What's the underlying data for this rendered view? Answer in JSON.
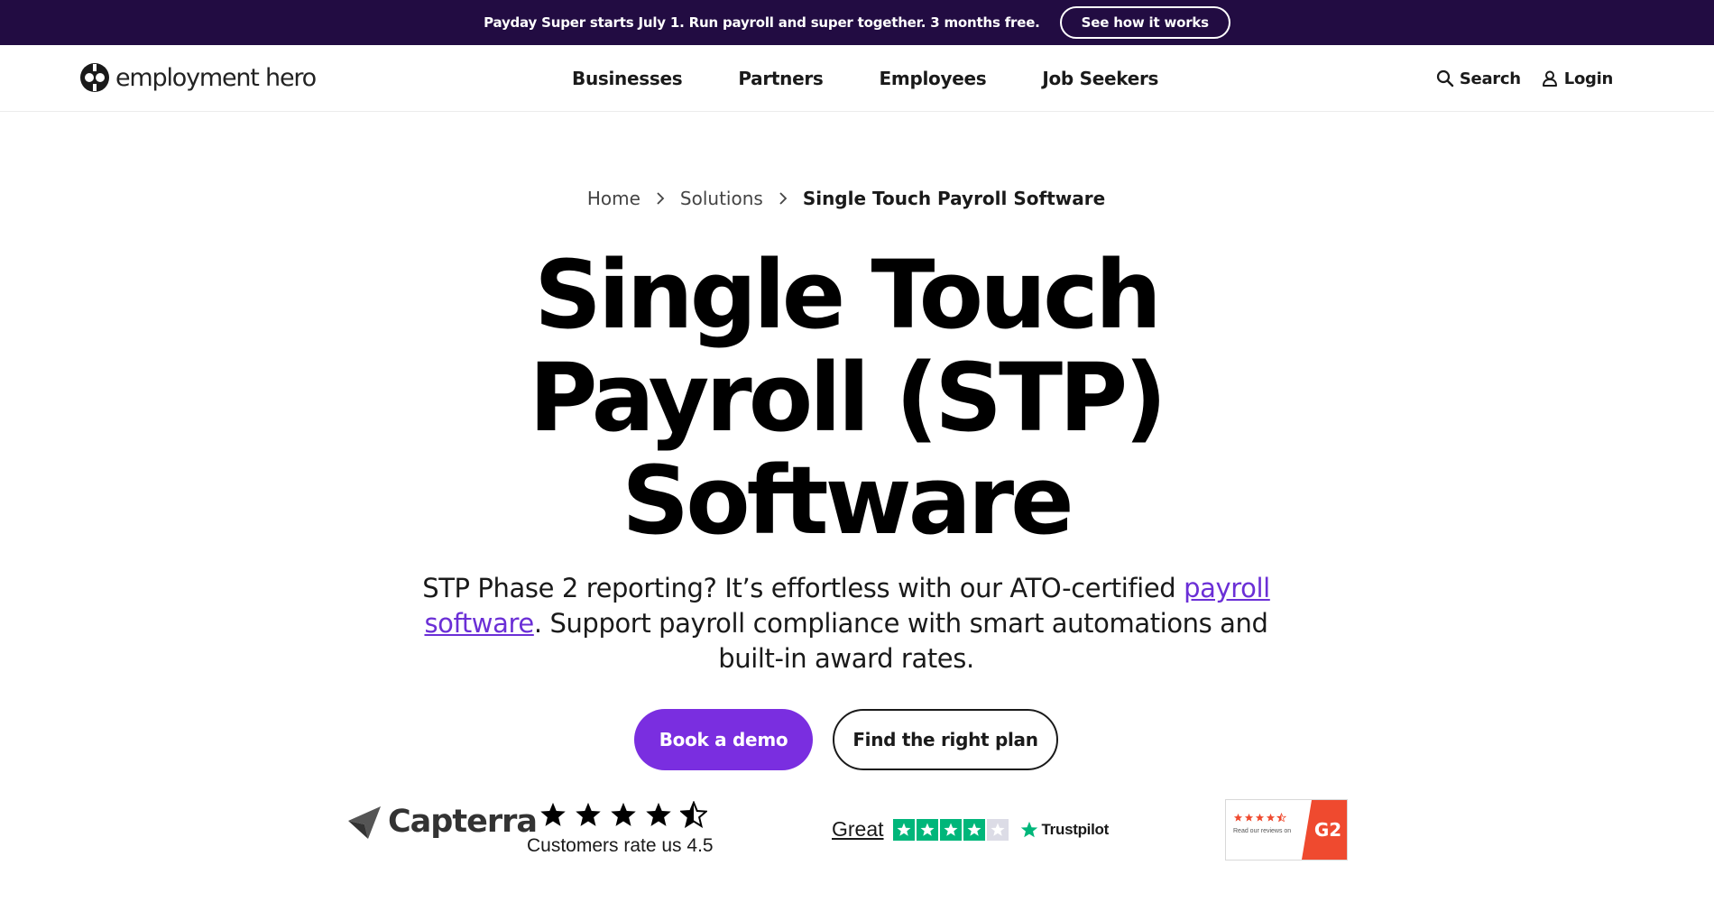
{
  "promo": {
    "text": "Payday Super starts July 1. Run payroll and super together. 3 months free.",
    "button": "See how it works"
  },
  "header": {
    "logo_text": "employment hero",
    "nav": [
      "Businesses",
      "Partners",
      "Employees",
      "Job Seekers"
    ],
    "search_label": "Search",
    "login_label": "Login"
  },
  "breadcrumb": {
    "home": "Home",
    "solutions": "Solutions",
    "current": "Single Touch Payroll Software"
  },
  "hero": {
    "title_line1": "Single Touch",
    "title_line2": "Payroll (STP)",
    "title_line3": "Software",
    "subtitle_before": "STP Phase 2 reporting? It’s effortless with our ATO-certified ",
    "subtitle_link": "payroll software",
    "subtitle_after": ". Support payroll compliance with smart automations and built-in award rates.",
    "primary_cta": "Book a demo",
    "secondary_cta": "Find the right plan"
  },
  "ratings": {
    "capterra": {
      "name": "Capterra",
      "caption": "Customers rate us 4.5",
      "stars": 4.5
    },
    "trustpilot": {
      "label": "Great",
      "brand": "Trustpilot",
      "stars": 4
    },
    "g2": {
      "caption": "Read our reviews on",
      "brand": "G2",
      "stars": 4.5
    }
  },
  "colors": {
    "promo_bg": "#220c42",
    "accent": "#7a2ee0",
    "link": "#6b2fd6",
    "trustpilot_green": "#00b67a",
    "g2_red": "#ef4a2f"
  }
}
